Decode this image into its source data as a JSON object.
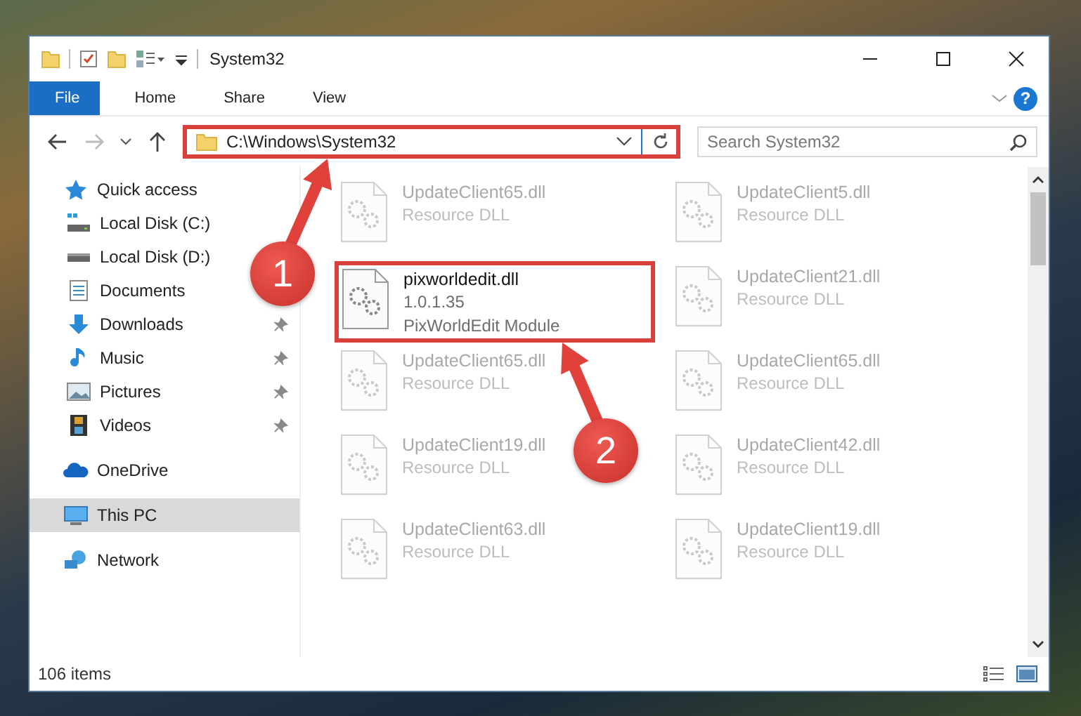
{
  "window": {
    "title": "System32"
  },
  "ribbon_tabs": [
    {
      "label": "File",
      "kind": "file"
    },
    {
      "label": "Home",
      "kind": "tab"
    },
    {
      "label": "Share",
      "kind": "tab"
    },
    {
      "label": "View",
      "kind": "tab"
    }
  ],
  "address_bar": {
    "path": "C:\\Windows\\System32",
    "highlighted": true
  },
  "search": {
    "placeholder": "Search System32"
  },
  "help_button": {
    "label": "?"
  },
  "sidebar": {
    "items": [
      {
        "label": "Quick access",
        "selected": false,
        "children": [
          {
            "label": "Local Disk (C:)",
            "selected": false,
            "pinned": false
          },
          {
            "label": "Local Disk (D:)",
            "selected": false,
            "pinned": false
          },
          {
            "label": "Documents",
            "selected": false,
            "pinned": false
          },
          {
            "label": "Downloads",
            "selected": false,
            "pinned": true
          },
          {
            "label": "Music",
            "selected": false,
            "pinned": true
          },
          {
            "label": "Pictures",
            "selected": false,
            "pinned": true
          },
          {
            "label": "Videos",
            "selected": false,
            "pinned": true
          }
        ]
      },
      {
        "label": "OneDrive",
        "selected": false
      },
      {
        "label": "This PC",
        "selected": true
      },
      {
        "label": "Network",
        "selected": false
      }
    ]
  },
  "files": [
    {
      "name": "UpdateClient65.dll",
      "details": [
        "Resource DLL"
      ],
      "highlighted": false
    },
    {
      "name": "UpdateClient5.dll",
      "details": [
        "Resource DLL"
      ],
      "highlighted": false
    },
    {
      "name": "pixworldedit.dll",
      "details": [
        "1.0.1.35",
        "PixWorldEdit Module"
      ],
      "highlighted": true
    },
    {
      "name": "UpdateClient21.dll",
      "details": [
        "Resource DLL"
      ],
      "highlighted": false
    },
    {
      "name": "UpdateClient65.dll",
      "details": [
        "Resource DLL"
      ],
      "highlighted": false
    },
    {
      "name": "UpdateClient65.dll",
      "details": [
        "Resource DLL"
      ],
      "highlighted": false
    },
    {
      "name": "UpdateClient19.dll",
      "details": [
        "Resource DLL"
      ],
      "highlighted": false
    },
    {
      "name": "UpdateClient42.dll",
      "details": [
        "Resource DLL"
      ],
      "highlighted": false
    },
    {
      "name": "UpdateClient63.dll",
      "details": [
        "Resource DLL"
      ],
      "highlighted": false
    },
    {
      "name": "UpdateClient19.dll",
      "details": [
        "Resource DLL"
      ],
      "highlighted": false
    }
  ],
  "status_bar": {
    "item_count": "106 items"
  },
  "annotations": [
    {
      "number": "1"
    },
    {
      "number": "2"
    }
  ]
}
